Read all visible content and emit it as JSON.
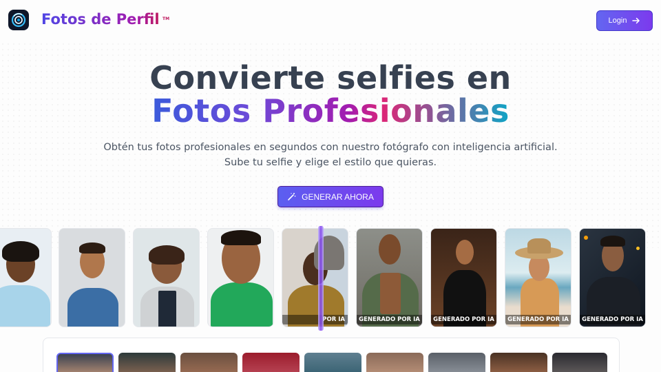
{
  "header": {
    "brand": "Fotos de Perfil",
    "trademark": "TM",
    "login_label": "Login"
  },
  "hero": {
    "title_line1": "Convierte selfies en",
    "title_line2": "Fotos Profesionales",
    "subtitle_line1": "Obtén tus fotos profesionales en segundos con nuestro fotógrafo con inteligencia artificial.",
    "subtitle_line2": "Sube tu selfie y elige el estilo que quieras.",
    "cta_label": "GENERAR AHORA"
  },
  "gallery": {
    "cards": [
      {
        "kind": "selfie",
        "tag": ""
      },
      {
        "kind": "selfie",
        "tag": ""
      },
      {
        "kind": "selfie",
        "tag": ""
      },
      {
        "kind": "selfie",
        "tag": ""
      },
      {
        "kind": "split",
        "tag": "POR IA"
      },
      {
        "kind": "generated",
        "tag": "GENERADO POR IA"
      },
      {
        "kind": "generated",
        "tag": "GENERADO POR IA"
      },
      {
        "kind": "generated",
        "tag": "GENERADO POR IA"
      },
      {
        "kind": "generated",
        "tag": "GENERADO POR IA"
      }
    ]
  },
  "colors": {
    "accent": "#6366f1",
    "brand_start": "#4f46e5",
    "brand_end": "#be185d"
  }
}
